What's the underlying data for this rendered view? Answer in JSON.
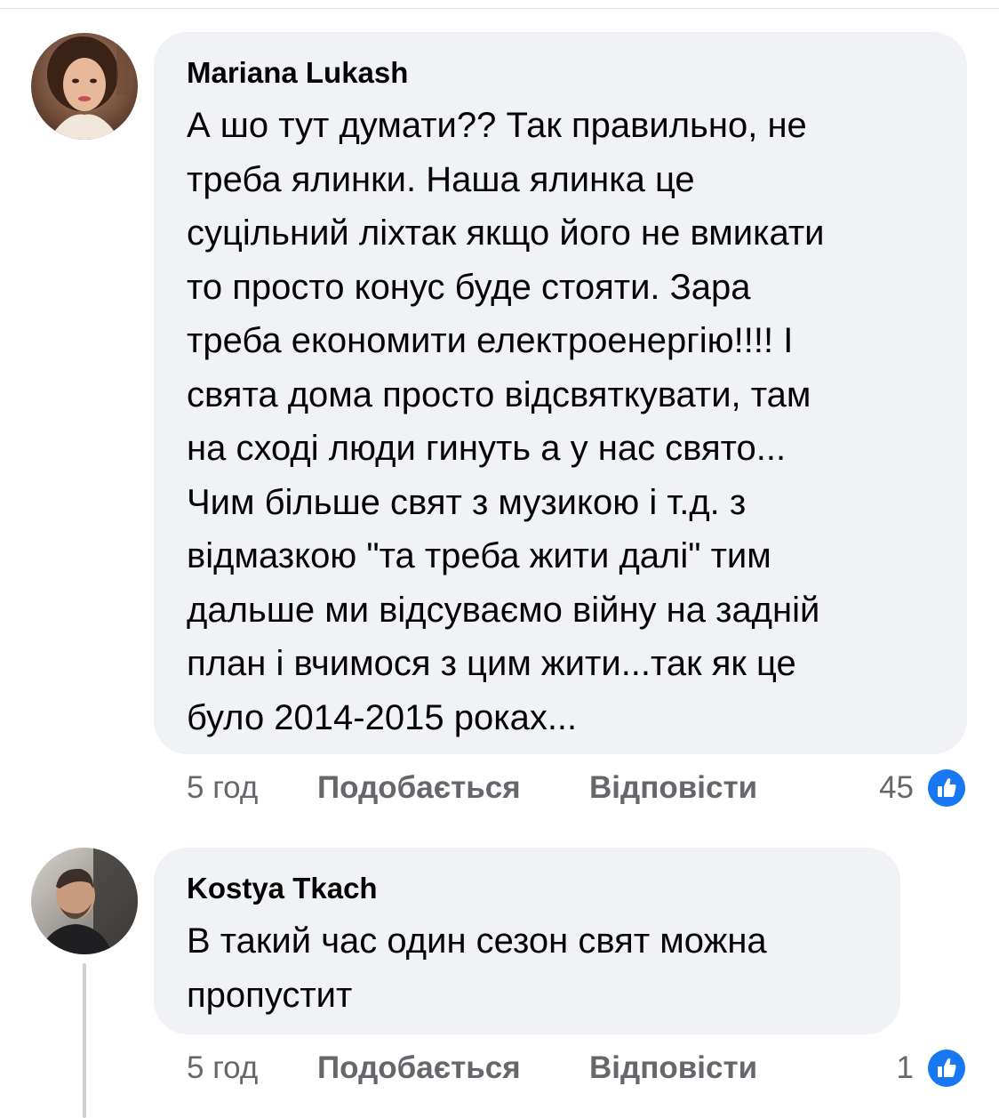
{
  "comments": [
    {
      "author": "Mariana Lukash",
      "avatar_icon": "profile-photo-woman",
      "lines": [
        "А шо тут думати?? Так правильно, не",
        "треба ялинки. Наша ялинка це",
        "суцільний ліхтак якщо його не вмикати",
        "то просто конус буде стояти. Зара",
        "треба економити електроенергію!!!! І",
        "свята дома просто відсвяткувати, там",
        "на сході люди гинуть а у нас свято...",
        "Чим більше свят з музикою і т.д. з",
        "відмазкою \"та треба жити далі\" тим",
        "дальше ми відсуваємо війну на задній",
        "план і вчимося з цим жити...так як це",
        "було 2014-2015 роках..."
      ],
      "time": "5 год",
      "like_label": "Подобається",
      "reply_label": "Відповісти",
      "reaction_count": "45",
      "reaction_icon": "like-icon"
    },
    {
      "author": "Kostya Tkach",
      "avatar_icon": "profile-photo-man",
      "lines": [
        "В такий час один сезон свят можна",
        "пропустит"
      ],
      "time": "5 год",
      "like_label": "Подобається",
      "reply_label": "Відповісти",
      "reaction_count": "1",
      "reaction_icon": "like-icon"
    }
  ],
  "colors": {
    "bubble_bg": "#f0f2f5",
    "meta_text": "#65676b",
    "like_blue": "#1877f2"
  }
}
